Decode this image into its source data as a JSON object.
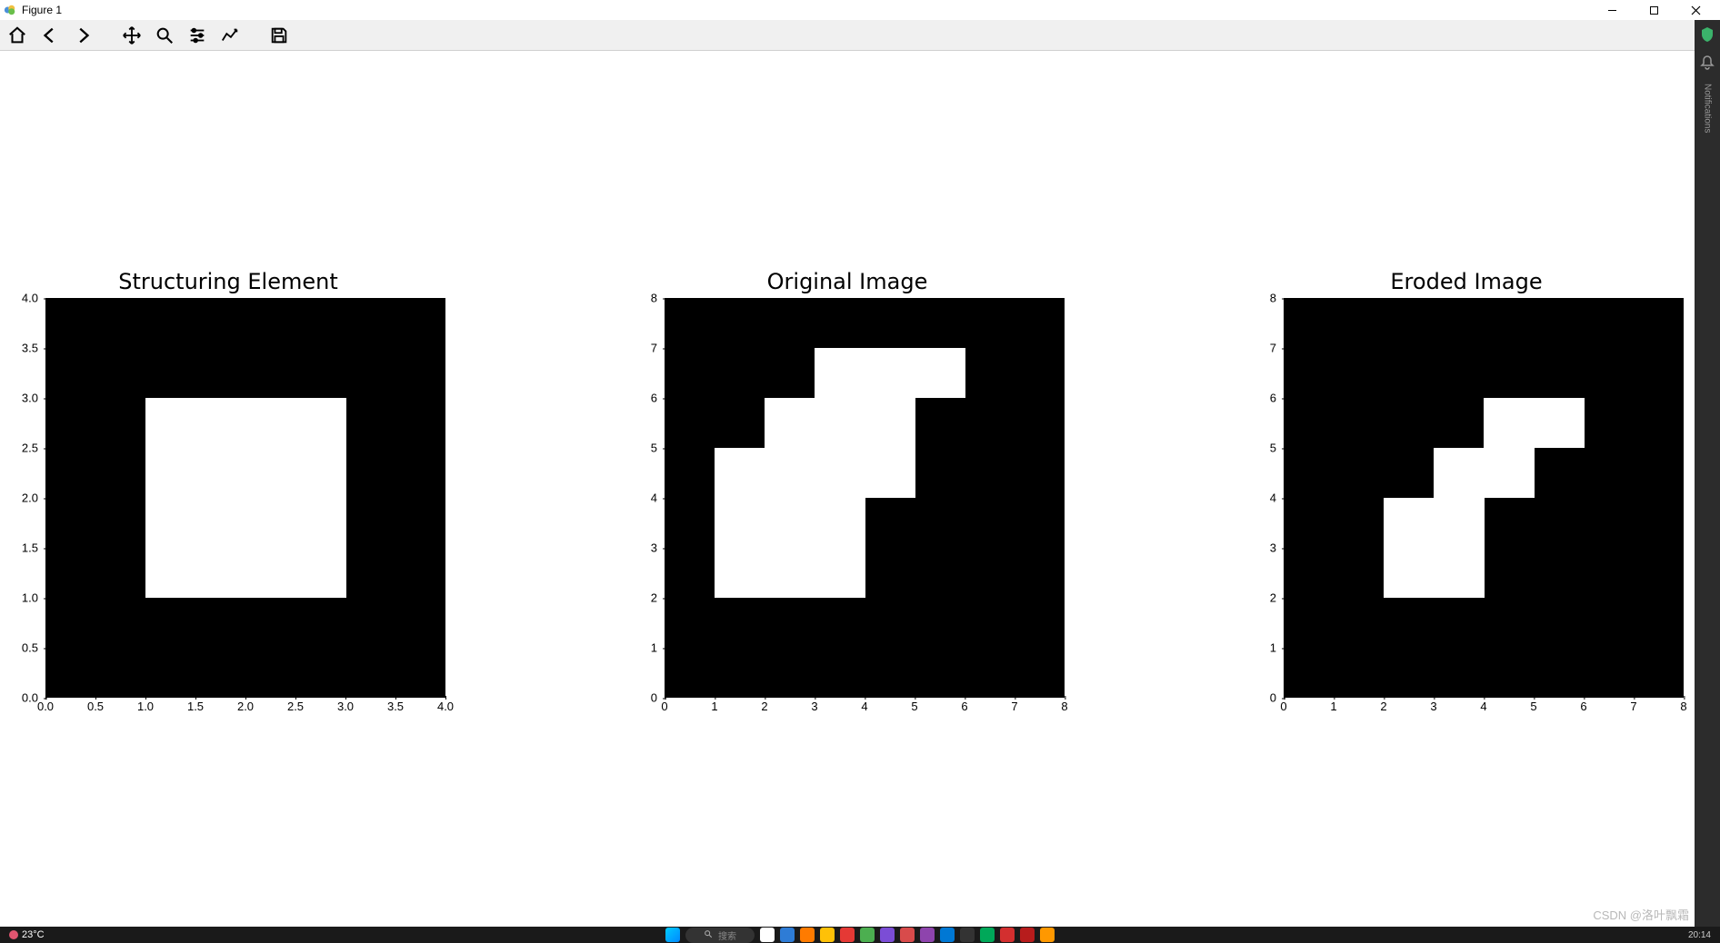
{
  "window": {
    "title": "Figure 1"
  },
  "toolbar": {
    "home": "home-icon",
    "back": "back-icon",
    "forward": "forward-icon",
    "pan": "pan-icon",
    "zoom": "zoom-icon",
    "configure": "configure-icon",
    "edit": "edit-icon",
    "save": "save-icon"
  },
  "chart_data": [
    {
      "type": "heatmap",
      "title": "Structuring Element",
      "xlabel": "",
      "ylabel": "",
      "xlim": [
        0.0,
        4.0
      ],
      "ylim": [
        0.0,
        4.0
      ],
      "xticks": [
        "0.0",
        "0.5",
        "1.0",
        "1.5",
        "2.0",
        "2.5",
        "3.0",
        "3.5",
        "4.0"
      ],
      "yticks": [
        "0.0",
        "0.5",
        "1.0",
        "1.5",
        "2.0",
        "2.5",
        "3.0",
        "3.5",
        "4.0"
      ],
      "grid": [
        [
          0,
          0,
          0,
          0
        ],
        [
          0,
          1,
          1,
          0
        ],
        [
          0,
          1,
          1,
          0
        ],
        [
          0,
          0,
          0,
          0
        ]
      ],
      "note": "grid[row][col], row 0 is y in [0,1), white cells cover x=1..3, y=1..3"
    },
    {
      "type": "heatmap",
      "title": "Original Image",
      "xlabel": "",
      "ylabel": "",
      "xlim": [
        0,
        8
      ],
      "ylim": [
        0,
        8
      ],
      "xticks": [
        "0",
        "1",
        "2",
        "3",
        "4",
        "5",
        "6",
        "7",
        "8"
      ],
      "yticks": [
        "0",
        "1",
        "2",
        "3",
        "4",
        "5",
        "6",
        "7",
        "8"
      ],
      "grid": [
        [
          0,
          0,
          0,
          0,
          0,
          0,
          0,
          0
        ],
        [
          0,
          0,
          0,
          0,
          0,
          0,
          0,
          0
        ],
        [
          0,
          1,
          1,
          1,
          0,
          0,
          0,
          0
        ],
        [
          0,
          1,
          1,
          1,
          0,
          0,
          0,
          0
        ],
        [
          0,
          1,
          1,
          1,
          1,
          0,
          0,
          0
        ],
        [
          0,
          0,
          1,
          1,
          1,
          0,
          0,
          0
        ],
        [
          0,
          0,
          0,
          1,
          1,
          1,
          0,
          0
        ],
        [
          0,
          0,
          0,
          0,
          0,
          0,
          0,
          0
        ]
      ]
    },
    {
      "type": "heatmap",
      "title": "Eroded Image",
      "xlabel": "",
      "ylabel": "",
      "xlim": [
        0,
        8
      ],
      "ylim": [
        0,
        8
      ],
      "xticks": [
        "0",
        "1",
        "2",
        "3",
        "4",
        "5",
        "6",
        "7",
        "8"
      ],
      "yticks": [
        "0",
        "1",
        "2",
        "3",
        "4",
        "5",
        "6",
        "7",
        "8"
      ],
      "grid": [
        [
          0,
          0,
          0,
          0,
          0,
          0,
          0,
          0
        ],
        [
          0,
          0,
          0,
          0,
          0,
          0,
          0,
          0
        ],
        [
          0,
          0,
          1,
          1,
          0,
          0,
          0,
          0
        ],
        [
          0,
          0,
          1,
          1,
          0,
          0,
          0,
          0
        ],
        [
          0,
          0,
          0,
          1,
          1,
          0,
          0,
          0
        ],
        [
          0,
          0,
          0,
          0,
          1,
          1,
          0,
          0
        ],
        [
          0,
          0,
          0,
          0,
          0,
          0,
          0,
          0
        ],
        [
          0,
          0,
          0,
          0,
          0,
          0,
          0,
          0
        ]
      ]
    }
  ],
  "watermark": "CSDN @洛叶飘霜",
  "taskbar": {
    "weather_temp": "23°C",
    "search_placeholder": "搜索",
    "time": "20:14"
  },
  "sidebar": {
    "label": "Notifications"
  }
}
